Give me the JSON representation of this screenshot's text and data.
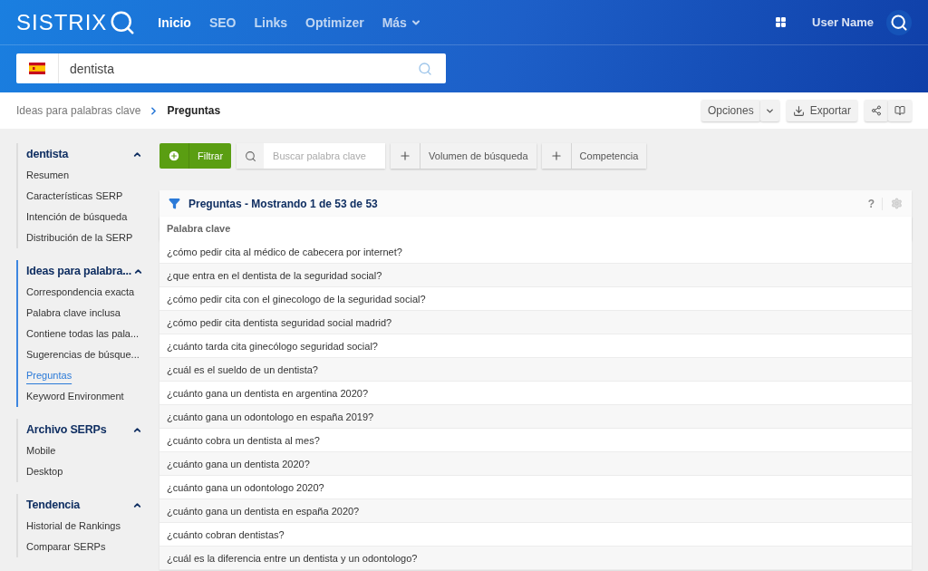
{
  "header": {
    "logo": "SISTRIX",
    "nav": [
      {
        "label": "Inicio",
        "selected": true
      },
      {
        "label": "SEO",
        "selected": false
      },
      {
        "label": "Links",
        "selected": false
      },
      {
        "label": "Optimizer",
        "selected": false
      }
    ],
    "more": {
      "label": "Más"
    },
    "user": "User Name"
  },
  "search": {
    "value": "dentista"
  },
  "breadcrumb": [
    {
      "label": "Ideas para palabras clave",
      "current": false
    },
    {
      "label": "Preguntas",
      "current": true
    }
  ],
  "actions": {
    "options": "Opciones",
    "export": "Exportar"
  },
  "sidebar": [
    {
      "title": "dentista",
      "expanded": true,
      "active": false,
      "items": [
        {
          "label": "Resumen",
          "selected": false
        },
        {
          "label": "Características SERP",
          "selected": false
        },
        {
          "label": "Intención de búsqueda",
          "selected": false
        },
        {
          "label": "Distribución de la SERP",
          "selected": false
        }
      ]
    },
    {
      "title": "Ideas para palabra...",
      "expanded": true,
      "active": true,
      "items": [
        {
          "label": "Correspondencia exacta",
          "selected": false
        },
        {
          "label": "Palabra clave inclusa",
          "selected": false
        },
        {
          "label": "Contiene todas las pala...",
          "selected": false
        },
        {
          "label": "Sugerencias de búsque...",
          "selected": false
        },
        {
          "label": "Preguntas",
          "selected": true
        },
        {
          "label": "Keyword Environment",
          "selected": false
        }
      ]
    },
    {
      "title": "Archivo SERPs",
      "expanded": true,
      "active": false,
      "items": [
        {
          "label": "Mobile",
          "selected": false
        },
        {
          "label": "Desktop",
          "selected": false
        }
      ]
    },
    {
      "title": "Tendencia",
      "expanded": true,
      "active": false,
      "items": [
        {
          "label": "Historial de Rankings",
          "selected": false
        },
        {
          "label": "Comparar SERPs",
          "selected": false
        }
      ]
    }
  ],
  "toolbar": {
    "filter": "Filtrar",
    "search_placeholder": "Buscar palabra clave",
    "adders": [
      "Volumen de búsqueda",
      "Competencia"
    ]
  },
  "table": {
    "title": "Preguntas - Mostrando 1 de 53 de 53",
    "help": "?",
    "columns": [
      "Palabra clave"
    ],
    "rows": [
      "¿cómo pedir cita al médico de cabecera por internet?",
      "¿que entra en el dentista de la seguridad social?",
      "¿cómo pedir cita con el ginecologo de la seguridad social?",
      "¿cómo pedir cita dentista seguridad social madrid?",
      "¿cuánto tarda cita ginecólogo seguridad social?",
      "¿cuál es el sueldo de un dentista?",
      "¿cuánto gana un dentista en argentina 2020?",
      "¿cuánto gana un odontologo en españa 2019?",
      "¿cuánto cobra un dentista al mes?",
      "¿cuánto gana un dentista 2020?",
      "¿cuánto gana un odontologo 2020?",
      "¿cuánto gana un dentista en españa 2020?",
      "¿cuánto cobran dentistas?",
      "¿cuál es la diferencia entre un dentista y un odontologo?"
    ]
  }
}
